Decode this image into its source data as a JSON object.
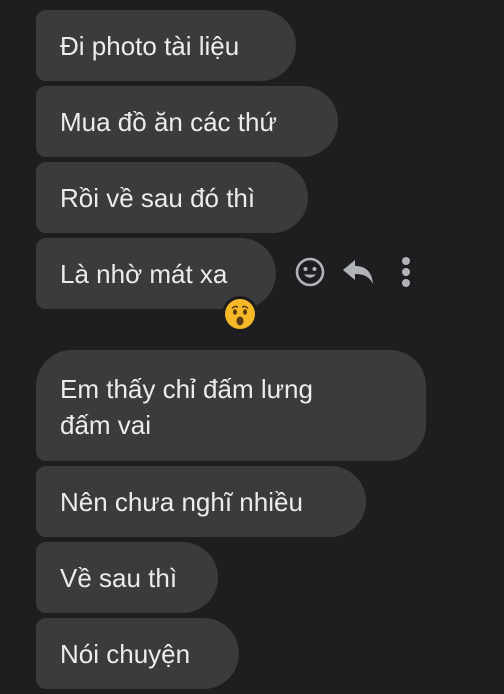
{
  "messages": [
    "Đi photo tài liệu",
    "Mua đồ ăn các thứ",
    "Rồi về sau đó thì",
    "Là nhờ mát xa",
    "Em thấy chỉ đấm lưng\nđấm vai",
    "Nên chưa nghĩ nhiều",
    "Về sau thì",
    "Nói chuyện"
  ],
  "actions": [
    "smiley-face-icon",
    "reply-arrow-icon",
    "more-vertical-icon"
  ],
  "reaction": {
    "icon": "surprised-face-emoji",
    "on_message_index": 3
  },
  "colors": {
    "background": "#1e1e20",
    "bubble": "#3a3b3d",
    "text": "#ececec",
    "icon": "#b0b3b8",
    "emoji_face": "#f7b928"
  }
}
